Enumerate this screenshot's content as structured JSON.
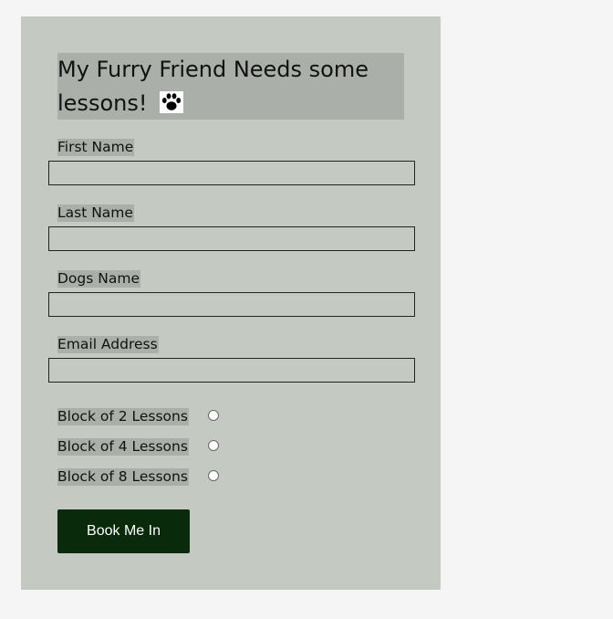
{
  "form": {
    "title": "My Furry Friend Needs some lessons!",
    "title_icon": "paw-icon",
    "fields": [
      {
        "label": "First Name",
        "value": "",
        "placeholder": ""
      },
      {
        "label": "Last Name",
        "value": "",
        "placeholder": ""
      },
      {
        "label": "Dogs Name",
        "value": "",
        "placeholder": ""
      },
      {
        "label": "Email Address",
        "value": "",
        "placeholder": ""
      }
    ],
    "options": [
      {
        "label": "Block of 2 Lessons",
        "selected": false
      },
      {
        "label": "Block of 4 Lessons",
        "selected": false
      },
      {
        "label": "Block of 8 Lessons",
        "selected": false
      }
    ],
    "submit_label": "Book Me In"
  },
  "colors": {
    "page_background": "#f5f5f5",
    "card_background": "#c4c9c2",
    "label_highlight": "#aab0a9",
    "button_background": "#0a2a0c",
    "button_text": "#ffffff"
  }
}
